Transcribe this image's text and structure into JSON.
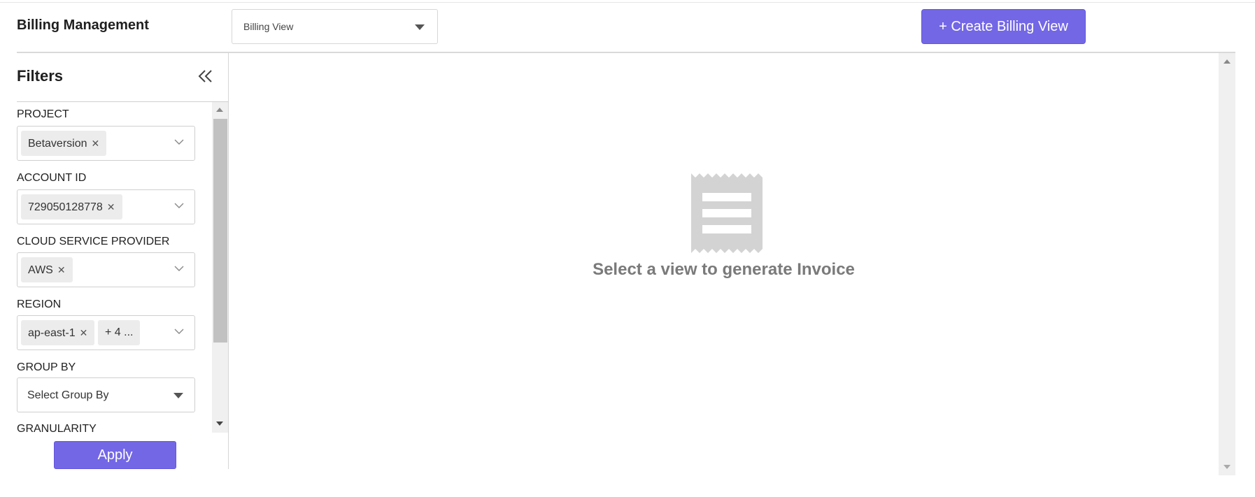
{
  "header": {
    "title": "Billing Management",
    "view_select": {
      "value": "Billing View"
    },
    "create_button": "+ Create Billing View"
  },
  "filters": {
    "title": "Filters",
    "fields": [
      {
        "label": "PROJECT",
        "chips": [
          "Betaversion"
        ]
      },
      {
        "label": "ACCOUNT ID",
        "chips": [
          "729050128778"
        ]
      },
      {
        "label": "CLOUD SERVICE PROVIDER",
        "chips": [
          "AWS"
        ]
      },
      {
        "label": "REGION",
        "chips": [
          "ap-east-1"
        ],
        "more": "+ 4 ..."
      },
      {
        "label": "GROUP BY",
        "placeholder": "Select Group By"
      },
      {
        "label": "GRANULARITY"
      }
    ],
    "apply_button": "Apply"
  },
  "main": {
    "empty_message": "Select a view to generate Invoice"
  },
  "colors": {
    "accent": "#7367e6",
    "empty_icon": "#d3d3d3",
    "empty_text": "#7a7a7a"
  },
  "icons": {
    "collapse": "double-chevron-left-icon",
    "chip_remove": "close-icon",
    "dropdown": "chevron-down-icon",
    "empty_state": "receipt-icon"
  }
}
